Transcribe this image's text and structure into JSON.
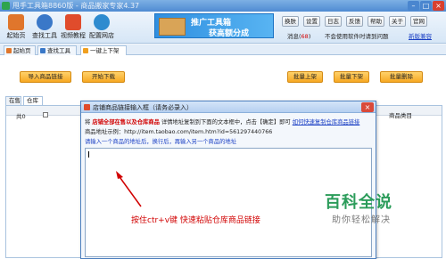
{
  "window": {
    "title": "甩手工具箱8860版 - 商品搬家专家4.37",
    "min": "–",
    "max": "□",
    "close": "×"
  },
  "toolbar": {
    "items": [
      {
        "label": "起始页",
        "color": "#e0762c"
      },
      {
        "label": "查找工具",
        "color": "#3a78c8"
      },
      {
        "label": "视频教程",
        "color": "#e04c2c"
      },
      {
        "label": "配置网店",
        "color": "#2e8bcf"
      }
    ],
    "banner_line1": "推广工具箱",
    "banner_line2": "获高额分成",
    "menu": [
      "换肤",
      "设置",
      "日志",
      "反馈",
      "帮助",
      "关于",
      "官网"
    ],
    "msg_prefix": "消息(",
    "msg_count": "68",
    "msg_suffix": ")",
    "startup_text": "不会使用软件时请到问题",
    "new_version": "新版兼容"
  },
  "tabs": [
    {
      "label": "起始页",
      "color": "#e0762c"
    },
    {
      "label": "查找工具",
      "color": "#3a78c8"
    },
    {
      "label": "一键上下架",
      "color": "#f0a020"
    }
  ],
  "actions": {
    "import": "导入商品链接",
    "start": "开始下载",
    "batch_up": "批量上架",
    "batch_down": "批量下架",
    "batch_delete": "批量删除"
  },
  "inner_tabs": [
    "在售",
    "仓库"
  ],
  "grid": {
    "total_prefix": "共",
    "total_count": "0",
    "col_category": "商品类目"
  },
  "dialog": {
    "title": "店铺商品链接输入框（请务必录入）",
    "line1_a": "将",
    "line1_red": "店铺全部在售以及仓库商品",
    "line1_b": "详情地址复制到下面的文本框中，点击【确定】即可",
    "line1_link": "如何快速复制仓库商品链接",
    "line2": "商品地址示例：http://item.taobao.com/item.htm?id=561297440766",
    "line3": "请输入一个商品的地址后，换行后，再输入另一个商品的地址",
    "close": "×"
  },
  "annotation": "按住ctr+v键 快速粘贴仓库商品链接",
  "watermark": {
    "line1": "百科全说",
    "line2": "助你轻松解决"
  }
}
